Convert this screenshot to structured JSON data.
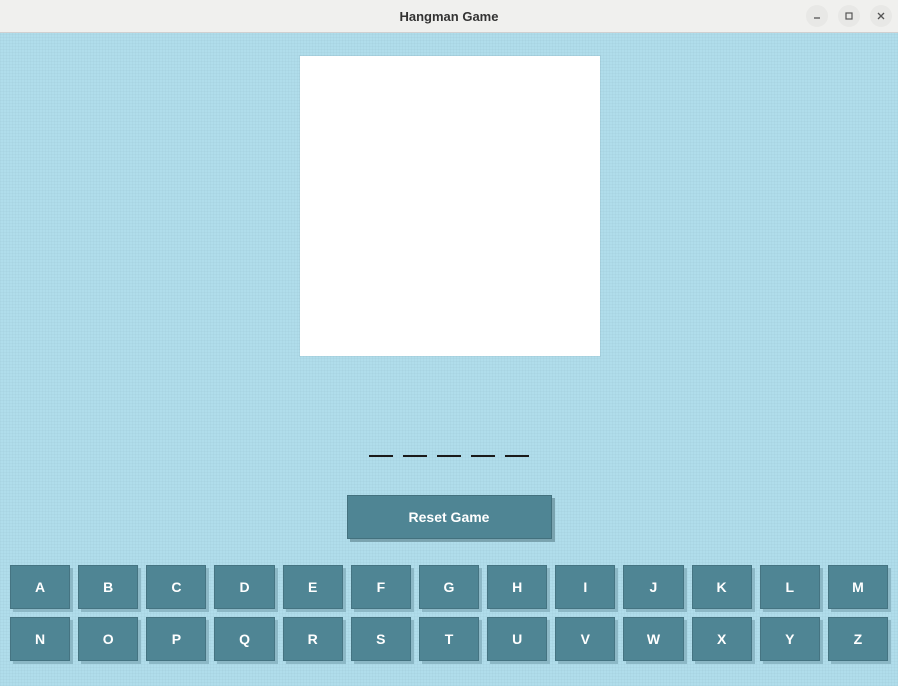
{
  "window": {
    "title": "Hangman Game"
  },
  "game": {
    "word_length": 5,
    "blanks": [
      "_",
      "_",
      "_",
      "_",
      "_"
    ],
    "reset_label": "Reset Game"
  },
  "keyboard": {
    "letters": [
      "A",
      "B",
      "C",
      "D",
      "E",
      "F",
      "G",
      "H",
      "I",
      "J",
      "K",
      "L",
      "M",
      "N",
      "O",
      "P",
      "Q",
      "R",
      "S",
      "T",
      "U",
      "V",
      "W",
      "X",
      "Y",
      "Z"
    ]
  },
  "colors": {
    "app_bg": "#b0ddeb",
    "button_bg": "#4f8594",
    "button_text": "#ffffff",
    "canvas_bg": "#ffffff"
  }
}
